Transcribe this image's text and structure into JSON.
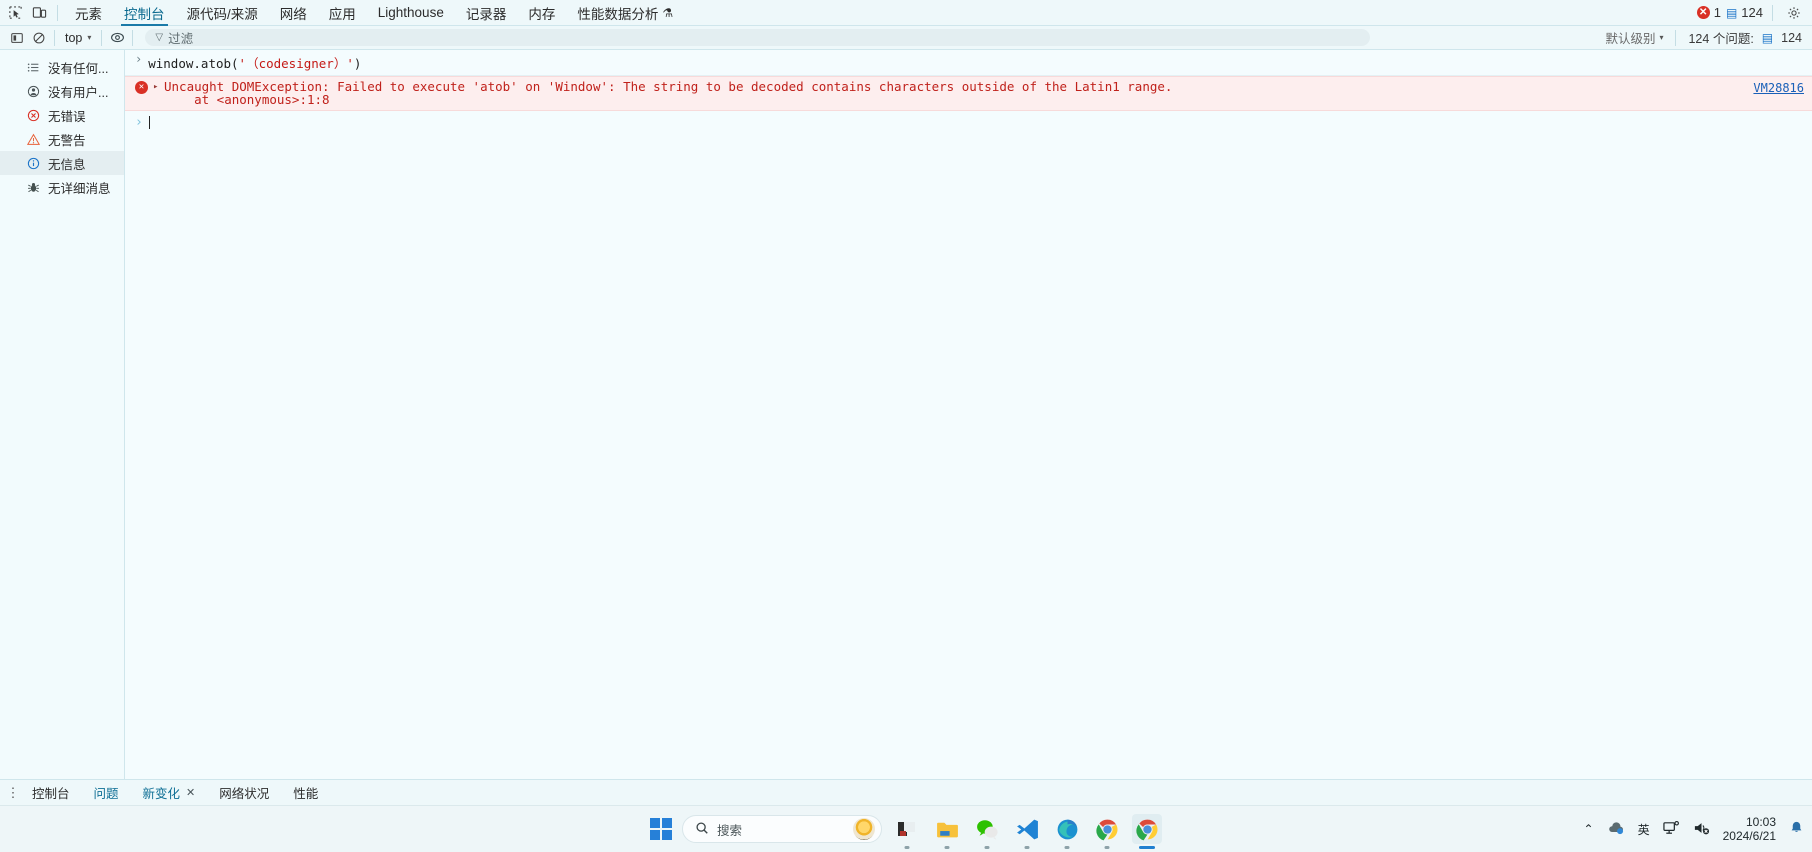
{
  "devtools": {
    "tabbar": {
      "inspect_icon": "inspect-element-icon",
      "device_icon": "device-toolbar-icon",
      "tabs": [
        {
          "label": "元素",
          "active": false
        },
        {
          "label": "控制台",
          "active": true
        },
        {
          "label": "源代码/来源",
          "active": false
        },
        {
          "label": "网络",
          "active": false
        },
        {
          "label": "应用",
          "active": false
        },
        {
          "label": "Lighthouse",
          "active": false
        },
        {
          "label": "记录器",
          "active": false,
          "flask": ""
        },
        {
          "label": "内存",
          "active": false
        },
        {
          "label": "性能数据分析",
          "active": false,
          "flask": "⚗"
        }
      ],
      "error_count": "1",
      "message_count": "124",
      "settings_icon": "gear-icon"
    },
    "toolbar": {
      "clear_icon": "clear-console-icon",
      "noblock_icon": "no-entry-icon",
      "context": "top",
      "context_caret": "▾",
      "eye_icon": "live-expression-icon",
      "filter_icon": "funnel-icon",
      "filter_placeholder": "过滤",
      "filter_value": "",
      "levels_label": "默认级别",
      "levels_caret": "▾",
      "issues_text": "124 个问题:",
      "issues_count": "124"
    },
    "sidebar": [
      {
        "icon": "list-icon",
        "label": "没有任何...",
        "selected": false
      },
      {
        "icon": "user-icon",
        "label": "没有用户...",
        "selected": false
      },
      {
        "icon": "error-circle-icon",
        "label": "无错误",
        "selected": false
      },
      {
        "icon": "warning-triangle-icon",
        "label": "无警告",
        "selected": false
      },
      {
        "icon": "info-circle-icon",
        "label": "无信息",
        "selected": true
      },
      {
        "icon": "bug-icon",
        "label": "无详细消息",
        "selected": false
      }
    ],
    "console": {
      "input_row": {
        "chevron": "›",
        "code_prefix": "window.atob(",
        "code_string": "'（codesigner）'",
        "code_suffix": ")"
      },
      "error_row": {
        "icon": "error-circle-icon",
        "expander": "▸",
        "message": "Uncaught DOMException: Failed to execute 'atob' on 'Window': The string to be decoded contains characters outside of the Latin1 range.",
        "stack": "    at <anonymous>:1:8",
        "source_link": "VM28816"
      },
      "prompt_row": {
        "chevron": "›",
        "value": ""
      }
    },
    "drawer": {
      "menu_icon": "more-vertical-icon",
      "tabs": [
        {
          "label": "控制台",
          "accent": false,
          "closable": false
        },
        {
          "label": "问题",
          "accent": true,
          "closable": false
        },
        {
          "label": "新变化",
          "accent": true,
          "closable": true,
          "close": "✕"
        },
        {
          "label": "网络状况",
          "accent": false,
          "closable": false
        },
        {
          "label": "性能",
          "accent": false,
          "closable": false
        }
      ]
    }
  },
  "taskbar": {
    "start_icon": "windows-start-icon",
    "search_icon": "search-icon",
    "search_placeholder": "搜索",
    "copilot_icon": "copilot-icon",
    "apps": [
      {
        "name": "file-explorer-dark-icon",
        "active": false
      },
      {
        "name": "file-explorer-icon",
        "active": false
      },
      {
        "name": "wechat-icon",
        "active": false
      },
      {
        "name": "vscode-icon",
        "active": false
      },
      {
        "name": "edge-icon",
        "active": false
      },
      {
        "name": "chrome-icon",
        "active": false
      },
      {
        "name": "chrome-icon",
        "active": true
      }
    ],
    "tray": {
      "overflow_icon": "chevron-up-icon",
      "cloud_sync_icon": "onedrive-icon",
      "ime_label": "英",
      "display_icon": "display-icon",
      "volume_icon": "volume-muted-icon",
      "time": "10:03",
      "date": "2024/6/21",
      "notification_icon": "bell-icon"
    }
  }
}
